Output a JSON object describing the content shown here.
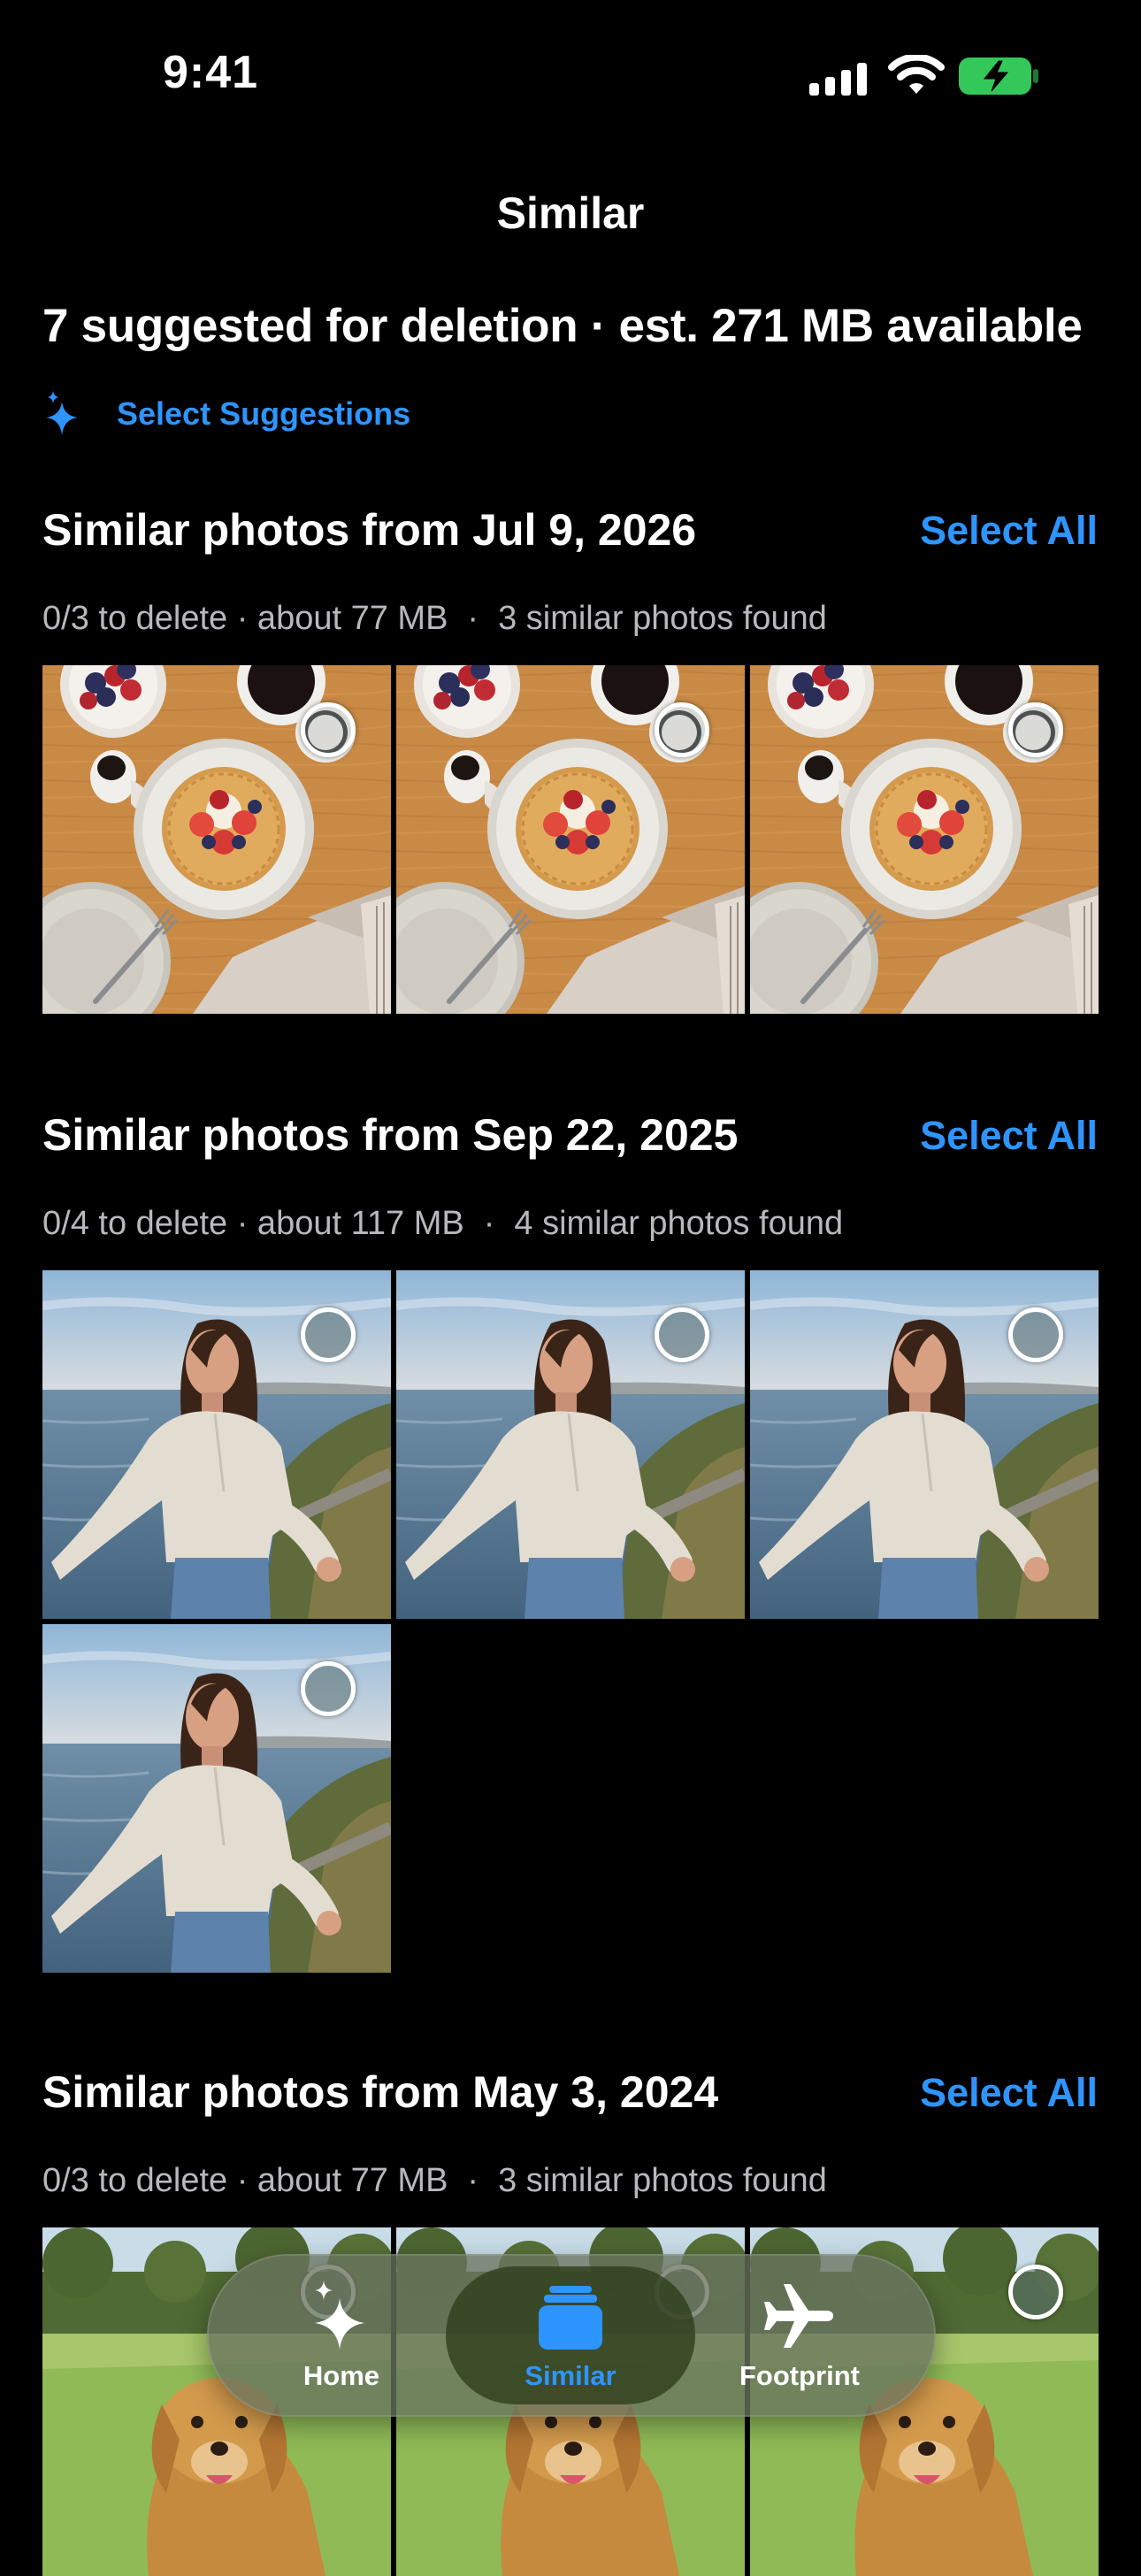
{
  "status_bar": {
    "time": "9:41"
  },
  "header": {
    "title": "Similar",
    "summary": "7 suggested for deletion · est. 271 MB available",
    "select_suggestions": "Select Suggestions"
  },
  "sections": [
    {
      "title": "Similar photos from Jul 9, 2026",
      "select_all": "Select All",
      "to_delete": "0/3 to delete · about 77 MB",
      "found": "3 similar photos found",
      "photo_subject": "breakfast-pancakes",
      "photo_count": 3
    },
    {
      "title": "Similar photos from Sep 22, 2025",
      "select_all": "Select All",
      "to_delete": "0/4 to delete · about 117 MB",
      "found": "4 similar photos found",
      "photo_subject": "woman-coast-portrait",
      "photo_count": 4
    },
    {
      "title": "Similar photos from May 3, 2024",
      "select_all": "Select All",
      "to_delete": "0/3 to delete · about 77 MB",
      "found": "3 similar photos found",
      "photo_subject": "golden-retriever-park",
      "photo_count": 3
    }
  ],
  "meta_separator": "·",
  "tab_bar": {
    "items": [
      {
        "label": "Home",
        "icon": "sparkles-icon",
        "active": false
      },
      {
        "label": "Similar",
        "icon": "stacked-photos-icon",
        "active": true
      },
      {
        "label": "Footprint",
        "icon": "airplane-icon",
        "active": false
      }
    ]
  },
  "colors": {
    "accent": "#2e95ff",
    "background": "#000000",
    "battery": "#34c759"
  }
}
